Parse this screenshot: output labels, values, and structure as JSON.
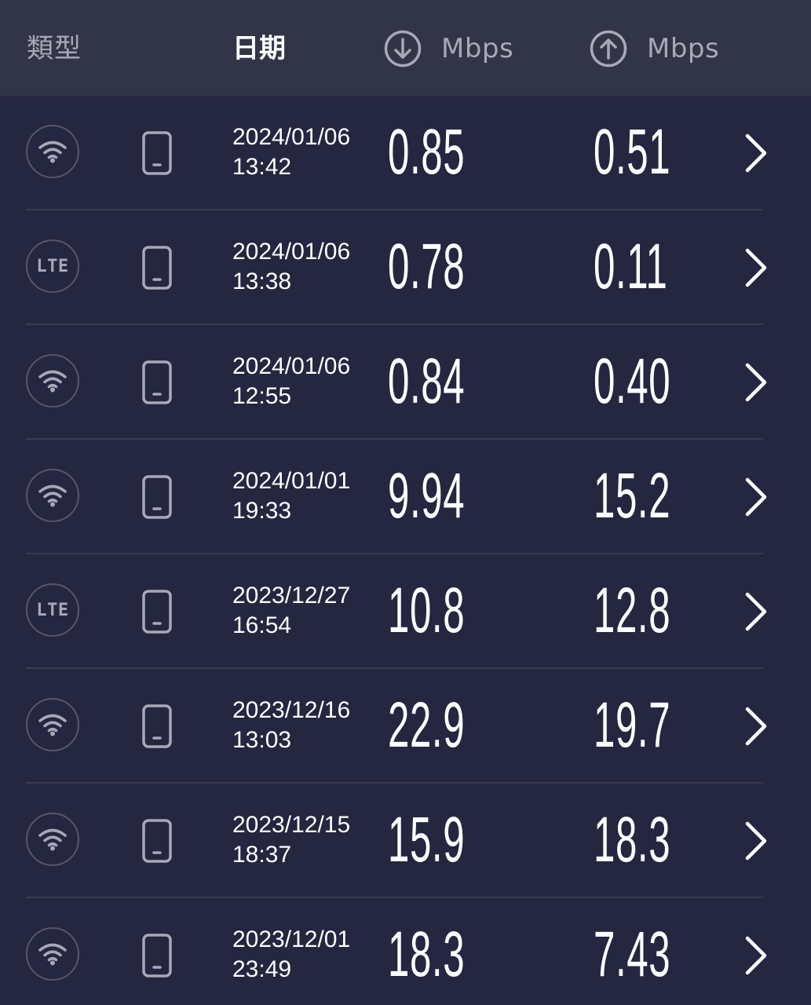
{
  "header": {
    "type_label": "類型",
    "date_label": "日期",
    "download_unit": "Mbps",
    "upload_unit": "Mbps",
    "download_icon": "download-arrow-icon",
    "upload_icon": "upload-arrow-icon"
  },
  "colors": {
    "background": "#252640",
    "header_background": "#323447",
    "muted_text": "#a7a9b7",
    "divider": "#3a3c53",
    "text": "#ffffff"
  },
  "results": [
    {
      "connection": "wifi",
      "connection_label": "",
      "device": "phone-icon",
      "date": "2024/01/06",
      "time": "13:42",
      "download": "0.85",
      "upload": "0.51"
    },
    {
      "connection": "lte",
      "connection_label": "LTE",
      "device": "phone-icon",
      "date": "2024/01/06",
      "time": "13:38",
      "download": "0.78",
      "upload": "0.11"
    },
    {
      "connection": "wifi",
      "connection_label": "",
      "device": "phone-icon",
      "date": "2024/01/06",
      "time": "12:55",
      "download": "0.84",
      "upload": "0.40"
    },
    {
      "connection": "wifi",
      "connection_label": "",
      "device": "phone-icon",
      "date": "2024/01/01",
      "time": "19:33",
      "download": "9.94",
      "upload": "15.2"
    },
    {
      "connection": "lte",
      "connection_label": "LTE",
      "device": "phone-icon",
      "date": "2023/12/27",
      "time": "16:54",
      "download": "10.8",
      "upload": "12.8"
    },
    {
      "connection": "wifi",
      "connection_label": "",
      "device": "phone-icon",
      "date": "2023/12/16",
      "time": "13:03",
      "download": "22.9",
      "upload": "19.7"
    },
    {
      "connection": "wifi",
      "connection_label": "",
      "device": "phone-icon",
      "date": "2023/12/15",
      "time": "18:37",
      "download": "15.9",
      "upload": "18.3"
    },
    {
      "connection": "wifi",
      "connection_label": "",
      "device": "phone-icon",
      "date": "2023/12/01",
      "time": "23:49",
      "download": "18.3",
      "upload": "7.43"
    }
  ]
}
